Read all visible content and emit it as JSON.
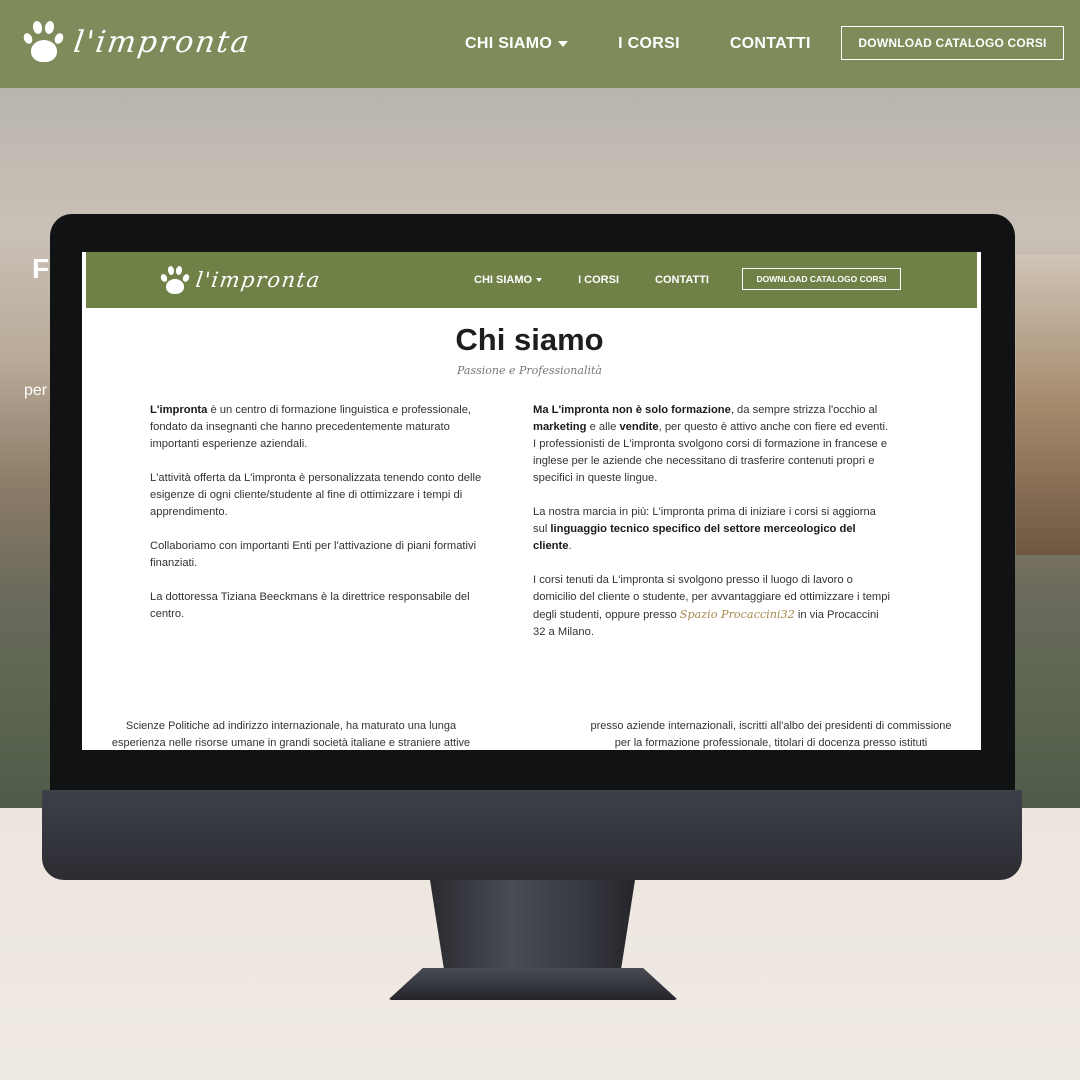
{
  "site": {
    "logo_text": "l'impronta",
    "nav": {
      "chi_siamo": "CHI SIAMO",
      "corsi": "I CORSI",
      "contatti": "CONTATTI",
      "download": "DOWNLOAD CATALOGO CORSI"
    },
    "hero_title_fragment": "F",
    "hero_sub_fragment": "per"
  },
  "screen": {
    "logo_text": "l'impronta",
    "nav": {
      "chi_siamo": "CHI SIAMO",
      "corsi": "I CORSI",
      "contatti": "CONTATTI",
      "download": "DOWNLOAD CATALOGO CORSI"
    },
    "title": "Chi siamo",
    "tagline": "Passione e Professionalità",
    "left": {
      "p1_bold": "L'impronta",
      "p1_rest": " è un centro di formazione linguistica e professionale, fondato da  insegnanti che hanno precedentemente maturato importanti esperienze aziendali.",
      "p2": "L'attività offerta da L'impronta è personalizzata tenendo conto delle esigenze di ogni cliente/studente al fine di ottimizzare i tempi di apprendimento.",
      "p3": "Collaboriamo con importanti Enti per l'attivazione di piani formativi finanziati.",
      "p4": "La dottoressa Tiziana Beeckmans è la direttrice responsabile del centro."
    },
    "right": {
      "p1_bold": "Ma L'impronta non è solo formazione",
      "p1_a": ", da sempre strizza l'occhio al ",
      "p1_bold2": "marketing",
      "p1_b": " e alle ",
      "p1_bold3": "vendite",
      "p1_c": ", per questo è attivo anche con fiere ed eventi. I professionisti de L'impronta svolgono corsi di formazione in francese e inglese per le aziende che necessitano di trasferire contenuti propri e specifici in queste lingue.",
      "p2_a": "La nostra marcia in più: L'impronta prima di iniziare i corsi si aggiorna sul ",
      "p2_bold": "linguaggio tecnico specifico del settore merceologico del cliente",
      "p2_b": ".",
      "p3_a": "I corsi tenuti da L'impronta si svolgono presso il luogo di lavoro o domicilio del cliente o studente, per avvantaggiare ed ottimizzare i tempi degli studenti, oppure presso ",
      "p3_link": "Spazio Procaccini32",
      "p3_b": " in via Procaccini 32 a Milano."
    },
    "bottom_left": "Scienze Politiche ad indirizzo internazionale, ha maturato una lunga esperienza nelle risorse umane in grandi società italiane e straniere attive",
    "bottom_right": "presso aziende internazionali, iscritti all'albo dei presidenti di commissione per la formazione professionale, titolari di docenza presso istituti"
  },
  "colors": {
    "header_green": "#7e8c5b",
    "inner_header_green": "#6f8147",
    "link_gold": "#a8884d"
  },
  "icons": [
    "paw-logo-icon",
    "chevron-down-icon",
    "apple-icon"
  ]
}
